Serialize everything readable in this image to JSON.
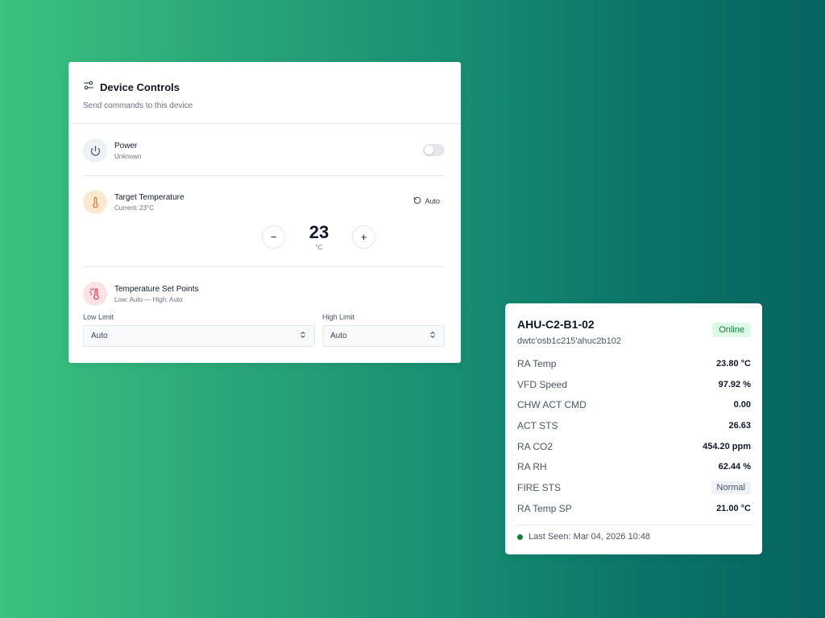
{
  "device_controls": {
    "title": "Device Controls",
    "subtitle": "Send commands to this device",
    "power": {
      "label": "Power",
      "status": "Unknown",
      "enabled": false
    },
    "target_temperature": {
      "label": "Target Temperature",
      "current": "Current: 23°C",
      "auto_label": "Auto",
      "value": "23",
      "unit": "°C",
      "decrement_label": "−",
      "increment_label": "+"
    },
    "set_points": {
      "label": "Temperature Set Points",
      "summary": "Low: Auto — High: Auto",
      "low_limit_label": "Low Limit",
      "low_limit_value": "Auto",
      "high_limit_label": "High Limit",
      "high_limit_value": "Auto"
    }
  },
  "device_status": {
    "name": "AHU-C2-B1-02",
    "id": "dwtc'osb1c215'ahuc2b102",
    "status_badge": "Online",
    "metrics": [
      {
        "label": "RA Temp",
        "value": "23.80 °C"
      },
      {
        "label": "VFD Speed",
        "value": "97.92 %"
      },
      {
        "label": "CHW ACT CMD",
        "value": "0.00"
      },
      {
        "label": "ACT STS",
        "value": "26.63"
      },
      {
        "label": "RA CO2",
        "value": "454.20 ppm"
      },
      {
        "label": "RA RH",
        "value": "62.44 %"
      },
      {
        "label": "FIRE STS",
        "value": "Normal"
      },
      {
        "label": "RA Temp SP",
        "value": "21.00 °C"
      }
    ],
    "last_seen": "Last Seen: Mar 04, 2026 10:48"
  },
  "colors": {
    "online_green": "#15803d",
    "temp_icon": "#e0752d",
    "setpoint_icon": "#e5485d"
  },
  "icons": {
    "title": "sliders-icon",
    "power": "power-icon",
    "temperature": "thermometer-icon",
    "set_points": "thermometer-sun-icon",
    "auto": "rotate-ccw-icon",
    "select": "chevrons-up-down-icon"
  }
}
